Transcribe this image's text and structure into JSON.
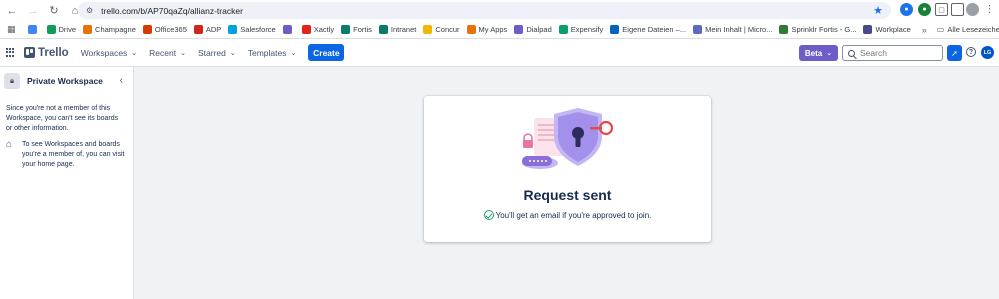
{
  "browser": {
    "url": "trello.com/b/AP70qaZq/allianz-tracker",
    "bookmarks": [
      {
        "label": "",
        "icon": "google-icon",
        "color": "#4285f4"
      },
      {
        "label": "Drive",
        "icon": "drive-icon",
        "color": "#0f9d58"
      },
      {
        "label": "Champagne",
        "icon": "champagne-icon",
        "color": "#e8710a"
      },
      {
        "label": "Office365",
        "icon": "office365-icon",
        "color": "#d83b01"
      },
      {
        "label": "ADP",
        "icon": "adp-icon",
        "color": "#d0271d"
      },
      {
        "label": "Salesforce",
        "icon": "salesforce-icon",
        "color": "#00a1e0"
      },
      {
        "label": "",
        "icon": "app-icon",
        "color": "#6e5dc6"
      },
      {
        "label": "Xactly",
        "icon": "xactly-icon",
        "color": "#e2231a"
      },
      {
        "label": "Fortis",
        "icon": "fortis-icon",
        "color": "#0b7b6c"
      },
      {
        "label": "Intranet",
        "icon": "intranet-icon",
        "color": "#0b7b6c"
      },
      {
        "label": "Concur",
        "icon": "concur-icon",
        "color": "#f2b705"
      },
      {
        "label": "My Apps",
        "icon": "myapps-icon",
        "color": "#e8710a"
      },
      {
        "label": "Dialpad",
        "icon": "dialpad-icon",
        "color": "#6e5dc6"
      },
      {
        "label": "Expensify",
        "icon": "expensify-icon",
        "color": "#0b9e6e"
      },
      {
        "label": "Eigene Dateien –...",
        "icon": "onedrive-icon",
        "color": "#0364b8"
      },
      {
        "label": "Mein Inhalt | Micro...",
        "icon": "microsoft-icon",
        "color": "#5c6bc0"
      },
      {
        "label": "Sprinklr Fortis - G...",
        "icon": "sprinklr-icon",
        "color": "#2e7d32"
      },
      {
        "label": "Workplace",
        "icon": "workplace-icon",
        "color": "#4a4a8a"
      }
    ],
    "more_label": "»",
    "all_bookmarks_label": "Alle Lesezeichen"
  },
  "header": {
    "logo": "Trello",
    "menus": [
      "Workspaces",
      "Recent",
      "Starred",
      "Templates"
    ],
    "create_label": "Create",
    "beta_label": "Beta",
    "search_placeholder": "Search",
    "avatar_initials": "LG"
  },
  "sidebar": {
    "title": "Private Workspace",
    "notice": "Since you're not a member of this Workspace, you can't see its boards or other information.",
    "home_text": "To see Workspaces and boards you're a member of, you can visit your home page."
  },
  "card": {
    "title": "Request sent",
    "subtitle": "You'll get an email if you're approved to join."
  },
  "colors": {
    "accent": "#0c66e4",
    "beta": "#6e5dc6",
    "success": "#22a06b"
  }
}
